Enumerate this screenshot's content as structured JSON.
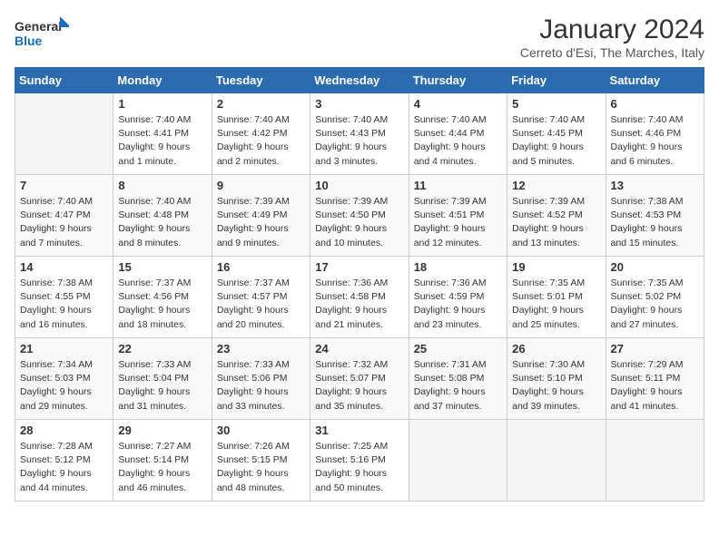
{
  "header": {
    "logo_line1": "General",
    "logo_line2": "Blue",
    "month": "January 2024",
    "location": "Cerreto d'Esi, The Marches, Italy"
  },
  "days_of_week": [
    "Sunday",
    "Monday",
    "Tuesday",
    "Wednesday",
    "Thursday",
    "Friday",
    "Saturday"
  ],
  "weeks": [
    [
      {
        "day": "",
        "info": ""
      },
      {
        "day": "1",
        "info": "Sunrise: 7:40 AM\nSunset: 4:41 PM\nDaylight: 9 hours\nand 1 minute."
      },
      {
        "day": "2",
        "info": "Sunrise: 7:40 AM\nSunset: 4:42 PM\nDaylight: 9 hours\nand 2 minutes."
      },
      {
        "day": "3",
        "info": "Sunrise: 7:40 AM\nSunset: 4:43 PM\nDaylight: 9 hours\nand 3 minutes."
      },
      {
        "day": "4",
        "info": "Sunrise: 7:40 AM\nSunset: 4:44 PM\nDaylight: 9 hours\nand 4 minutes."
      },
      {
        "day": "5",
        "info": "Sunrise: 7:40 AM\nSunset: 4:45 PM\nDaylight: 9 hours\nand 5 minutes."
      },
      {
        "day": "6",
        "info": "Sunrise: 7:40 AM\nSunset: 4:46 PM\nDaylight: 9 hours\nand 6 minutes."
      }
    ],
    [
      {
        "day": "7",
        "info": "Sunrise: 7:40 AM\nSunset: 4:47 PM\nDaylight: 9 hours\nand 7 minutes."
      },
      {
        "day": "8",
        "info": "Sunrise: 7:40 AM\nSunset: 4:48 PM\nDaylight: 9 hours\nand 8 minutes."
      },
      {
        "day": "9",
        "info": "Sunrise: 7:39 AM\nSunset: 4:49 PM\nDaylight: 9 hours\nand 9 minutes."
      },
      {
        "day": "10",
        "info": "Sunrise: 7:39 AM\nSunset: 4:50 PM\nDaylight: 9 hours\nand 10 minutes."
      },
      {
        "day": "11",
        "info": "Sunrise: 7:39 AM\nSunset: 4:51 PM\nDaylight: 9 hours\nand 12 minutes."
      },
      {
        "day": "12",
        "info": "Sunrise: 7:39 AM\nSunset: 4:52 PM\nDaylight: 9 hours\nand 13 minutes."
      },
      {
        "day": "13",
        "info": "Sunrise: 7:38 AM\nSunset: 4:53 PM\nDaylight: 9 hours\nand 15 minutes."
      }
    ],
    [
      {
        "day": "14",
        "info": "Sunrise: 7:38 AM\nSunset: 4:55 PM\nDaylight: 9 hours\nand 16 minutes."
      },
      {
        "day": "15",
        "info": "Sunrise: 7:37 AM\nSunset: 4:56 PM\nDaylight: 9 hours\nand 18 minutes."
      },
      {
        "day": "16",
        "info": "Sunrise: 7:37 AM\nSunset: 4:57 PM\nDaylight: 9 hours\nand 20 minutes."
      },
      {
        "day": "17",
        "info": "Sunrise: 7:36 AM\nSunset: 4:58 PM\nDaylight: 9 hours\nand 21 minutes."
      },
      {
        "day": "18",
        "info": "Sunrise: 7:36 AM\nSunset: 4:59 PM\nDaylight: 9 hours\nand 23 minutes."
      },
      {
        "day": "19",
        "info": "Sunrise: 7:35 AM\nSunset: 5:01 PM\nDaylight: 9 hours\nand 25 minutes."
      },
      {
        "day": "20",
        "info": "Sunrise: 7:35 AM\nSunset: 5:02 PM\nDaylight: 9 hours\nand 27 minutes."
      }
    ],
    [
      {
        "day": "21",
        "info": "Sunrise: 7:34 AM\nSunset: 5:03 PM\nDaylight: 9 hours\nand 29 minutes."
      },
      {
        "day": "22",
        "info": "Sunrise: 7:33 AM\nSunset: 5:04 PM\nDaylight: 9 hours\nand 31 minutes."
      },
      {
        "day": "23",
        "info": "Sunrise: 7:33 AM\nSunset: 5:06 PM\nDaylight: 9 hours\nand 33 minutes."
      },
      {
        "day": "24",
        "info": "Sunrise: 7:32 AM\nSunset: 5:07 PM\nDaylight: 9 hours\nand 35 minutes."
      },
      {
        "day": "25",
        "info": "Sunrise: 7:31 AM\nSunset: 5:08 PM\nDaylight: 9 hours\nand 37 minutes."
      },
      {
        "day": "26",
        "info": "Sunrise: 7:30 AM\nSunset: 5:10 PM\nDaylight: 9 hours\nand 39 minutes."
      },
      {
        "day": "27",
        "info": "Sunrise: 7:29 AM\nSunset: 5:11 PM\nDaylight: 9 hours\nand 41 minutes."
      }
    ],
    [
      {
        "day": "28",
        "info": "Sunrise: 7:28 AM\nSunset: 5:12 PM\nDaylight: 9 hours\nand 44 minutes."
      },
      {
        "day": "29",
        "info": "Sunrise: 7:27 AM\nSunset: 5:14 PM\nDaylight: 9 hours\nand 46 minutes."
      },
      {
        "day": "30",
        "info": "Sunrise: 7:26 AM\nSunset: 5:15 PM\nDaylight: 9 hours\nand 48 minutes."
      },
      {
        "day": "31",
        "info": "Sunrise: 7:25 AM\nSunset: 5:16 PM\nDaylight: 9 hours\nand 50 minutes."
      },
      {
        "day": "",
        "info": ""
      },
      {
        "day": "",
        "info": ""
      },
      {
        "day": "",
        "info": ""
      }
    ]
  ]
}
